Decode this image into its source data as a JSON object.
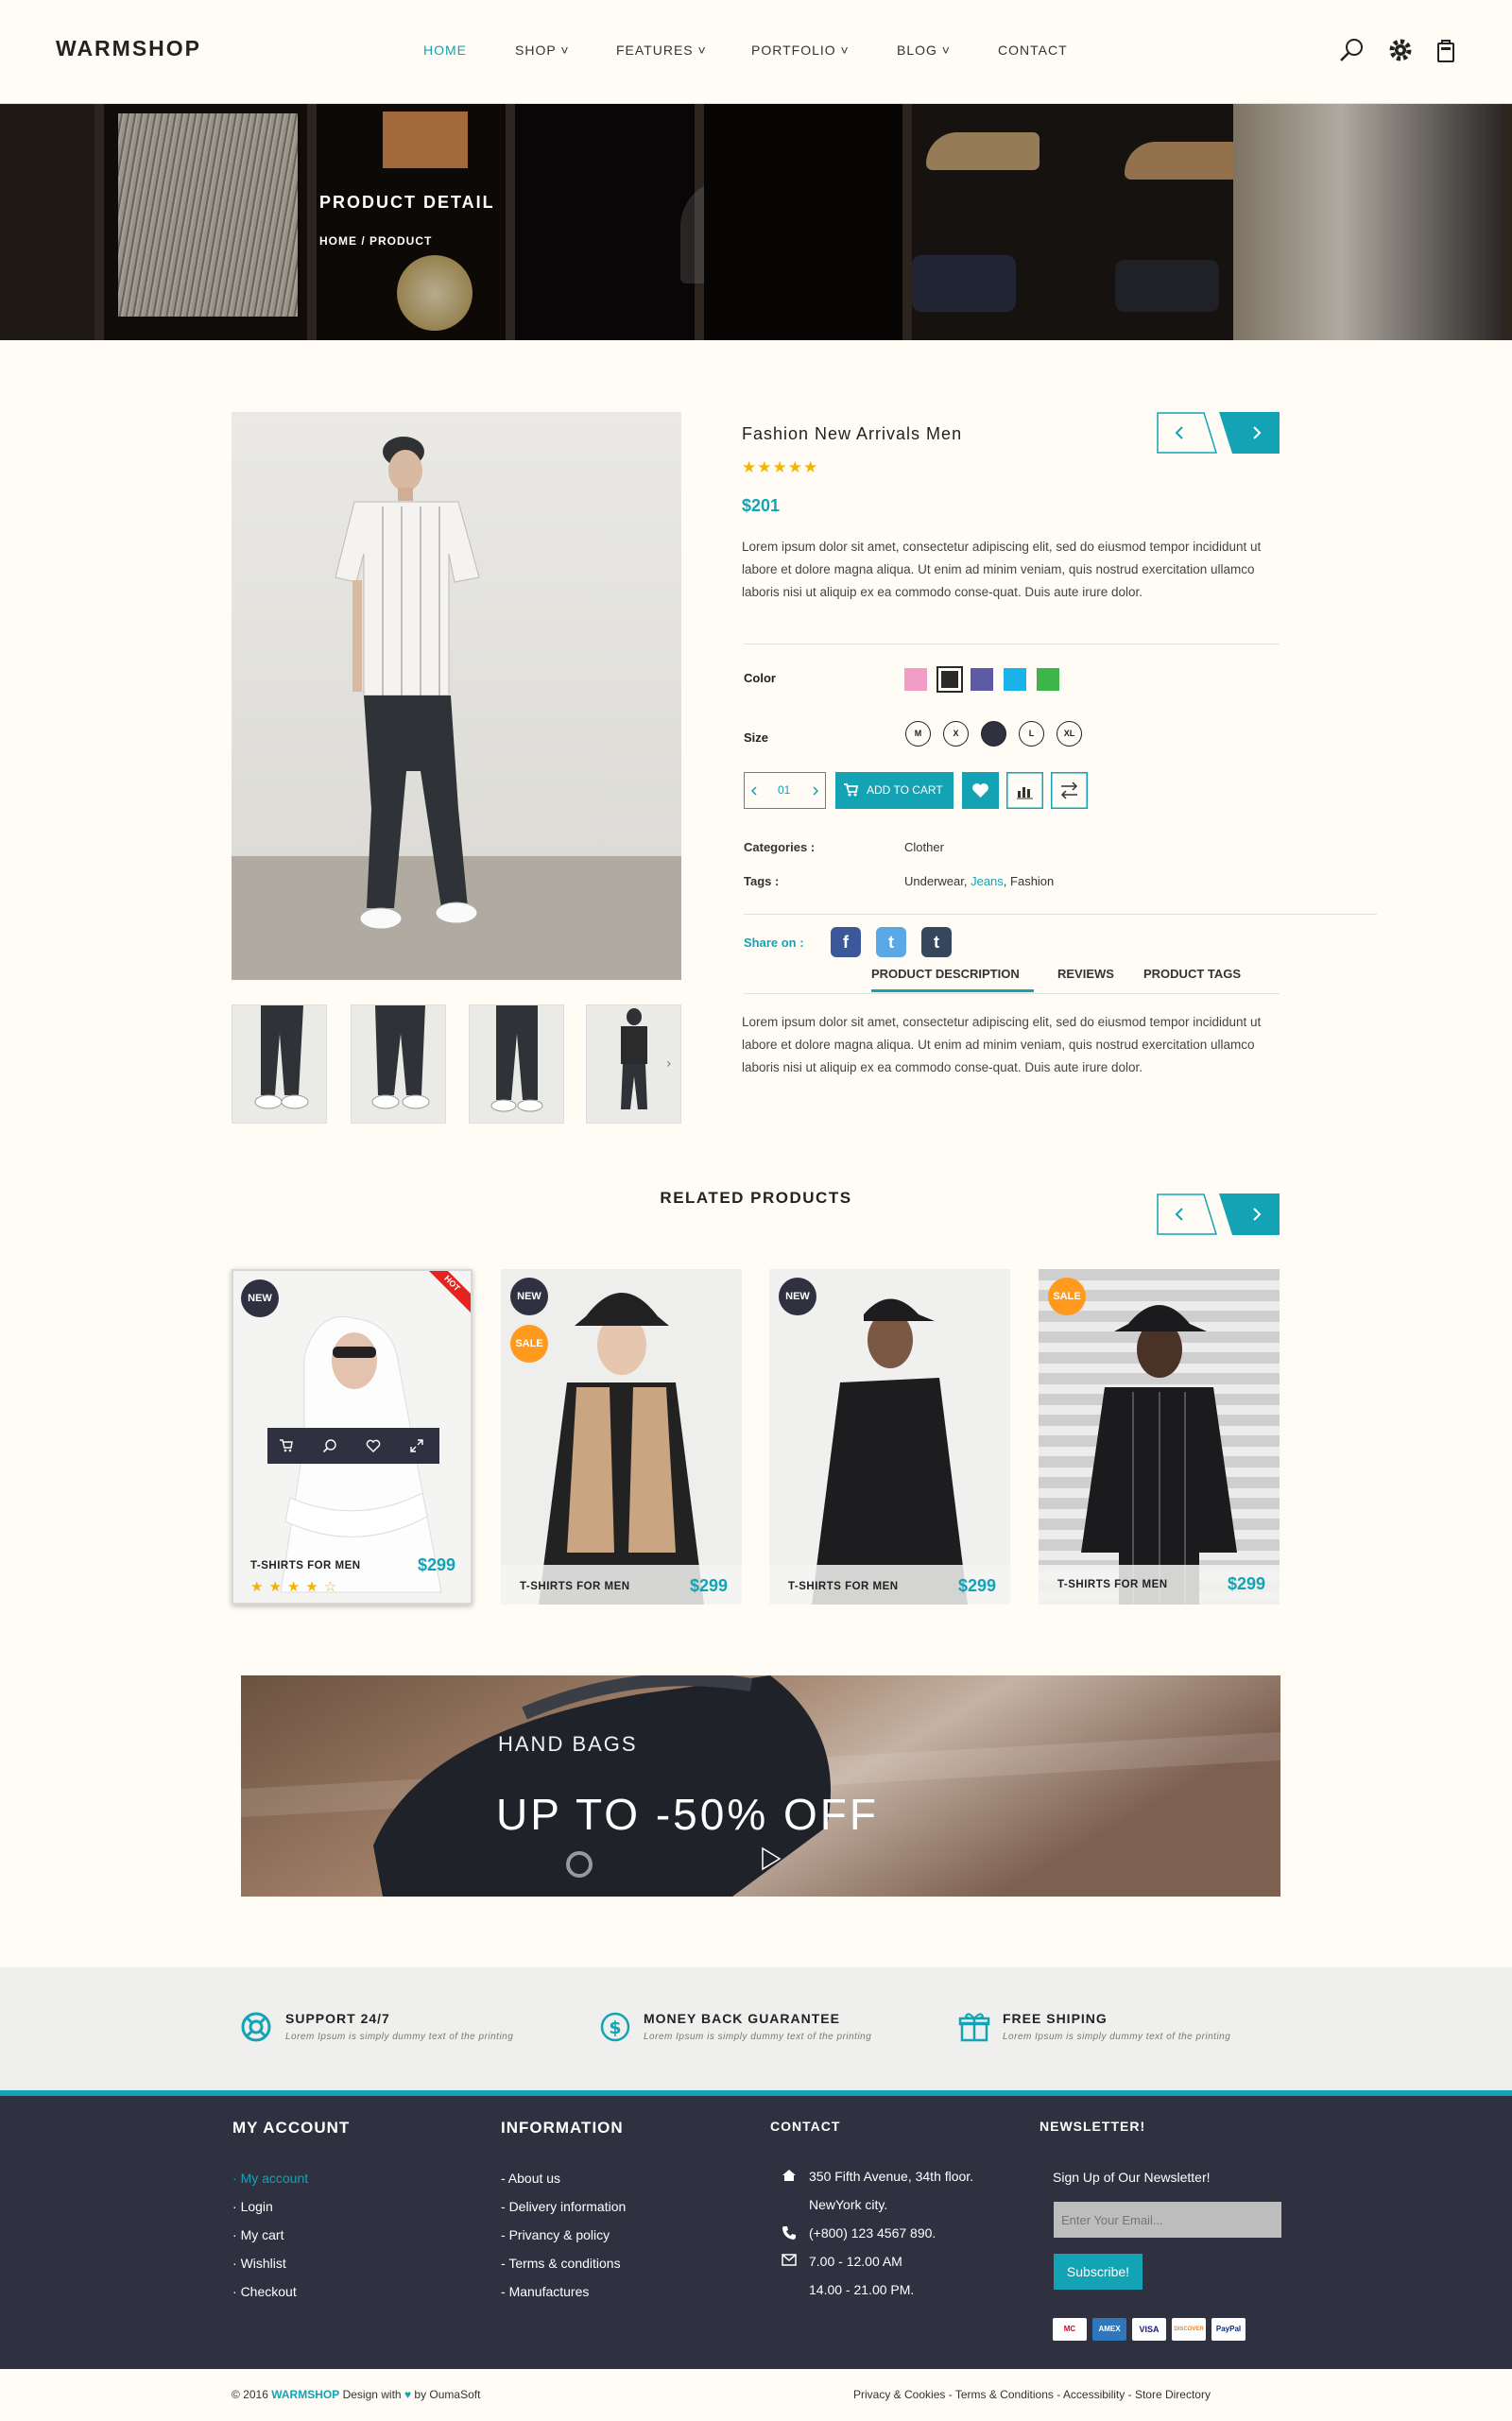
{
  "header": {
    "logo": "WARMSHOP",
    "nav": [
      "HOME",
      "SHOP",
      "FEATURES",
      "PORTFOLIO",
      "BLOG",
      "CONTACT"
    ],
    "dropdown_marker": "˅"
  },
  "hero": {
    "title": "PRODUCT DETAIL",
    "breadcrumb": "HOME / PRODUCT"
  },
  "product": {
    "title": "Fashion New Arrivals Men",
    "rating": 5,
    "stars": "★★★★★",
    "price": "$201",
    "description": "Lorem ipsum dolor sit amet, consectetur adipiscing elit, sed do eiusmod tempor incididunt ut labore et dolore magna aliqua. Ut enim ad minim veniam, quis nostrud exercitation ullamco laboris nisi ut aliquip ex ea commodo conse-quat. Duis aute irure dolor.",
    "color_label": "Color",
    "colors": [
      "#f39cc6",
      "#2a2a2a",
      "#5d5aa8",
      "#1ab2e8",
      "#3db54a"
    ],
    "size_label": "Size",
    "sizes": [
      "M",
      "X",
      "S",
      "L",
      "XL"
    ],
    "selected_size": "S",
    "quantity": "01",
    "add_to_cart": "ADD TO CART",
    "categories_label": "Categories :",
    "categories": "Clother",
    "tags_label": "Tags :",
    "tag1": "Underwear, ",
    "tag2": "Jeans",
    "tag3": ", Fashion",
    "share_label": "Share on :",
    "social": [
      "f",
      "t",
      "t"
    ],
    "tabs": [
      "PRODUCT DESCRIPTION",
      "REVIEWS",
      "PRODUCT TAGS"
    ],
    "tab_text": "Lorem ipsum dolor sit amet, consectetur adipiscing elit, sed do eiusmod tempor incididunt ut labore et dolore magna aliqua. Ut enim ad minim veniam, quis nostrud exercitation ullamco laboris nisi ut aliquip ex ea commodo conse-quat. Duis aute irure dolor."
  },
  "related": {
    "title": "RELATED PRODUCTS",
    "items": [
      {
        "name": "T-SHIRTS FOR MEN",
        "price": "$299",
        "badge1": "NEW",
        "ribbon": "HOT",
        "stars": "★★★★☆"
      },
      {
        "name": "T-SHIRTS FOR MEN",
        "price": "$299",
        "badge1": "NEW",
        "badge2": "SALE"
      },
      {
        "name": "T-SHIRTS FOR MEN",
        "price": "$299",
        "badge1": "NEW"
      },
      {
        "name": "T-SHIRTS FOR MEN",
        "price": "$299",
        "badge1": "SALE"
      }
    ]
  },
  "banner": {
    "subtitle": "HAND BAGS",
    "headline": "UP TO -50% OFF"
  },
  "services": [
    {
      "title": "SUPPORT 24/7",
      "desc": "Lorem Ipsum is simply dummy text of the printing"
    },
    {
      "title": "MONEY BACK GUARANTEE",
      "desc": "Lorem Ipsum is simply dummy text of the printing"
    },
    {
      "title": "FREE SHIPING",
      "desc": "Lorem Ipsum is simply dummy text of the printing"
    }
  ],
  "footer": {
    "account_title": "MY ACCOUNT",
    "account_links": [
      "My account",
      "Login",
      "My cart",
      "Wishlist",
      "Checkout"
    ],
    "info_title": "INFORMATION",
    "info_links": [
      "About us",
      "Delivery information",
      "Privancy & policy",
      "Terms & conditions",
      "Manufactures"
    ],
    "contact_title": "CONTACT",
    "address1": "350 Fifth Avenue, 34th floor.",
    "address2": "NewYork city.",
    "phone": "(+800) 123 4567 890.",
    "hours1": "7.00 - 12.00 AM",
    "hours2": "14.00 - 21.00 PM.",
    "newsletter_title": "NEWSLETTER!",
    "newsletter_text": "Sign Up of Our Newsletter!",
    "email_placeholder": "Enter Your Email...",
    "subscribe": "Subscribe!",
    "payments": [
      "MC",
      "AMEX",
      "VISA",
      "DISCOVER",
      "PayPal"
    ]
  },
  "bottom": {
    "copy": "© 2016 ",
    "brand": "WARMSHOP",
    "design": "Design with",
    "by": "by OumaSoft",
    "links": [
      "Privacy & Cookies",
      "Terms & Conditions",
      "Accessibility",
      "Store Directory"
    ],
    "separator": "-"
  }
}
